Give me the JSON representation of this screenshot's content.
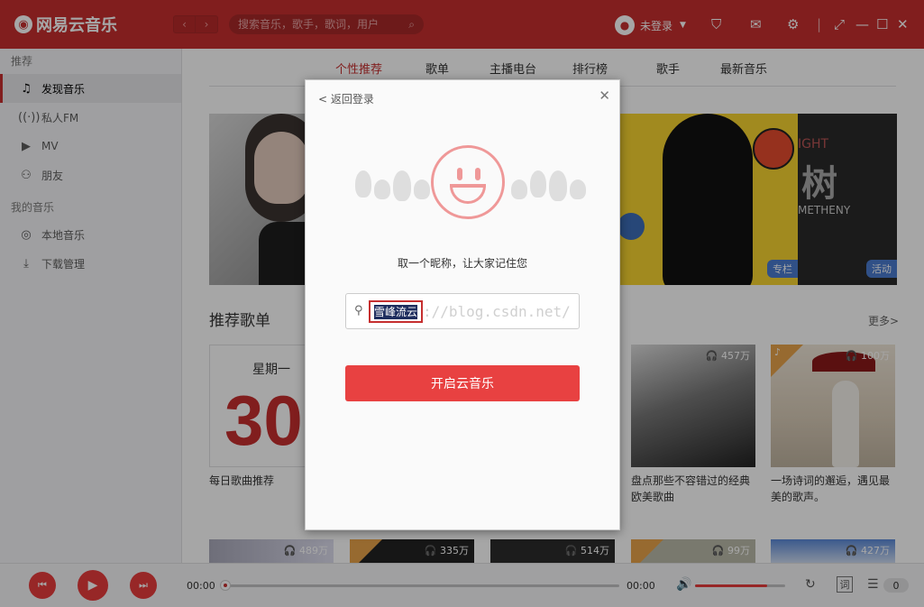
{
  "app": {
    "logo_text": "网易云音乐",
    "search_placeholder": "搜索音乐，歌手，歌词，用户",
    "user_label": "未登录"
  },
  "sidebar": {
    "section1": "推荐",
    "section2": "我的音乐",
    "items": [
      {
        "label": "发现音乐",
        "icon": "music-note-icon"
      },
      {
        "label": "私人FM",
        "icon": "radio-icon"
      },
      {
        "label": "MV",
        "icon": "video-icon"
      },
      {
        "label": "朋友",
        "icon": "friends-icon"
      },
      {
        "label": "本地音乐",
        "icon": "local-music-icon"
      },
      {
        "label": "下载管理",
        "icon": "download-icon"
      }
    ]
  },
  "tabs": [
    "个性推荐",
    "歌单",
    "主播电台",
    "排行榜",
    "歌手",
    "最新音乐"
  ],
  "banner": {
    "tag_column": "专栏",
    "tag_event": "活动",
    "dark_text_top": "IGHT",
    "dark_text_big": "树",
    "dark_text_bottom": "METHENY"
  },
  "section": {
    "title": "推荐歌单",
    "more": "更多>"
  },
  "playlists": [
    {
      "title": "每日歌曲推荐",
      "weekday": "星期一",
      "day": "30"
    },
    {
      "title": "盘点那些不容错过的经典欧美歌曲",
      "plays": "457万"
    },
    {
      "title": "一场诗词的邂逅，遇见最美的歌声。",
      "plays": "100万"
    }
  ],
  "row2_plays": [
    "489万",
    "335万",
    "514万",
    "99万",
    "427万"
  ],
  "player": {
    "time_current": "00:00",
    "time_total": "00:00",
    "lyric_label": "词",
    "playlist_count": "0",
    "progress": 0,
    "volume": 0.8
  },
  "modal": {
    "back_label": "< 返回登录",
    "prompt": "取一个昵称，让大家记住您",
    "nickname_value": "雪峰流云",
    "watermark": "://blog.csdn.net/",
    "start_button": "开启云音乐"
  }
}
